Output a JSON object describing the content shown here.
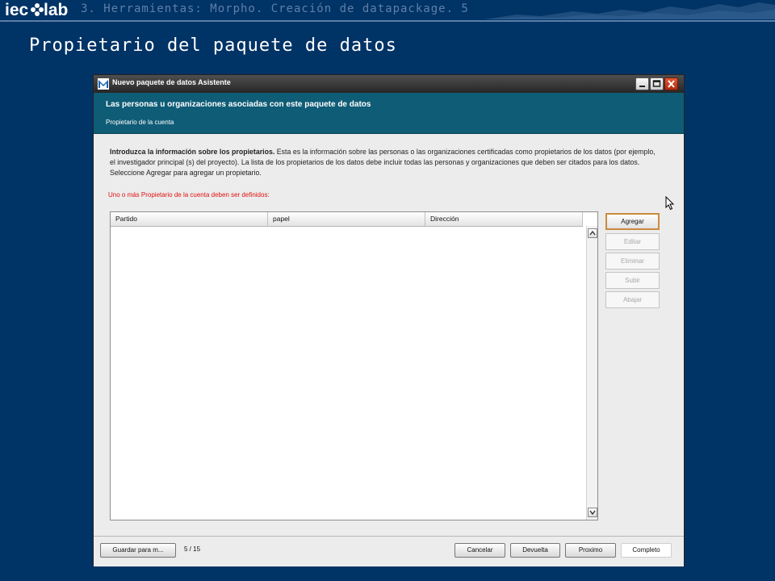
{
  "slide": {
    "logo_text": "iecolab",
    "breadcrumb": "3. Herramientas: Morpho. Creación de datapackage. 5",
    "title": "Propietario del paquete de datos"
  },
  "window": {
    "title": "Nuevo paquete de datos Asistente",
    "icons": {
      "app": "morpho-app-icon",
      "minimize": "minimize-icon",
      "maximize": "maximize-icon",
      "close": "close-icon"
    }
  },
  "banner": {
    "title": "Las personas u organizaciones asociadas con este paquete de datos",
    "subtitle": "Propietario de la cuenta"
  },
  "intro": {
    "bold": "Introduzca la información sobre los propietarios.",
    "text": " Esta es la información sobre las personas o las organizaciones certificadas como propietarios de los datos (por ejemplo, el investigador principal (s) del proyecto). La lista de los propietarios de los datos debe incluir todas las personas y organizaciones que deben ser citados para los datos. Seleccione Agregar para agregar un propietario."
  },
  "error_message": "Uno o más Propietario de la cuenta deben ser definidos:",
  "owners_table": {
    "columns": [
      "Partido",
      "papel",
      "Dirección"
    ],
    "rows": []
  },
  "side_buttons": {
    "add": "Agregar",
    "edit": "Editar",
    "delete": "Eliminar",
    "up": "Subir",
    "down": "Abajar"
  },
  "footer": {
    "save": "Guardar para m...",
    "page_indicator": "5 / 15",
    "cancel": "Cancelar",
    "back": "Devuelta",
    "next": "Proximo",
    "done": "Completo"
  },
  "colors": {
    "slide_background": "#003366",
    "banner": "#0f5c76",
    "error_text": "#e21111",
    "primary_button_border": "#c98a3e"
  }
}
